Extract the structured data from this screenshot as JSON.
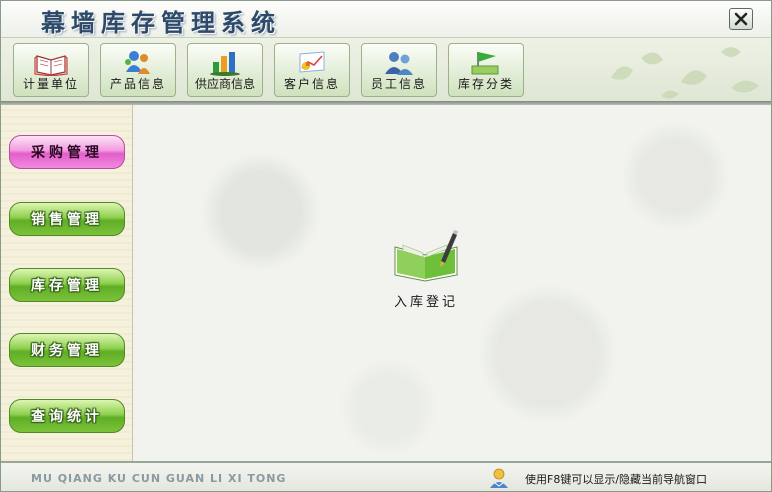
{
  "window": {
    "title": "幕墙库存管理系统",
    "close_icon": "close-icon"
  },
  "toolbar": {
    "items": [
      {
        "label": "计量单位",
        "icon": "book-icon"
      },
      {
        "label": "产品信息",
        "icon": "product-people-icon"
      },
      {
        "label": "供应商信息",
        "icon": "supplier-chart-icon"
      },
      {
        "label": "客户信息",
        "icon": "customer-chart-icon"
      },
      {
        "label": "员工信息",
        "icon": "employees-icon"
      },
      {
        "label": "库存分类",
        "icon": "stock-category-icon"
      }
    ]
  },
  "sidebar": {
    "items": [
      {
        "label": "采购管理",
        "active": true
      },
      {
        "label": "销售管理",
        "active": false
      },
      {
        "label": "库存管理",
        "active": false
      },
      {
        "label": "财务管理",
        "active": false
      },
      {
        "label": "查询统计",
        "active": false
      }
    ]
  },
  "main": {
    "entry": {
      "label": "入库登记",
      "icon": "notebook-pen-icon"
    }
  },
  "footer": {
    "pinyin": "MU QIANG KU CUN  GUAN LI XI TONG",
    "hint": "使用F8键可以显示/隐藏当前导航窗口",
    "hint_icon": "user-info-icon"
  },
  "colors": {
    "title": "#2d4a6a",
    "nav_green": "#7cc23a",
    "nav_active_pink": "#e25ecb"
  }
}
